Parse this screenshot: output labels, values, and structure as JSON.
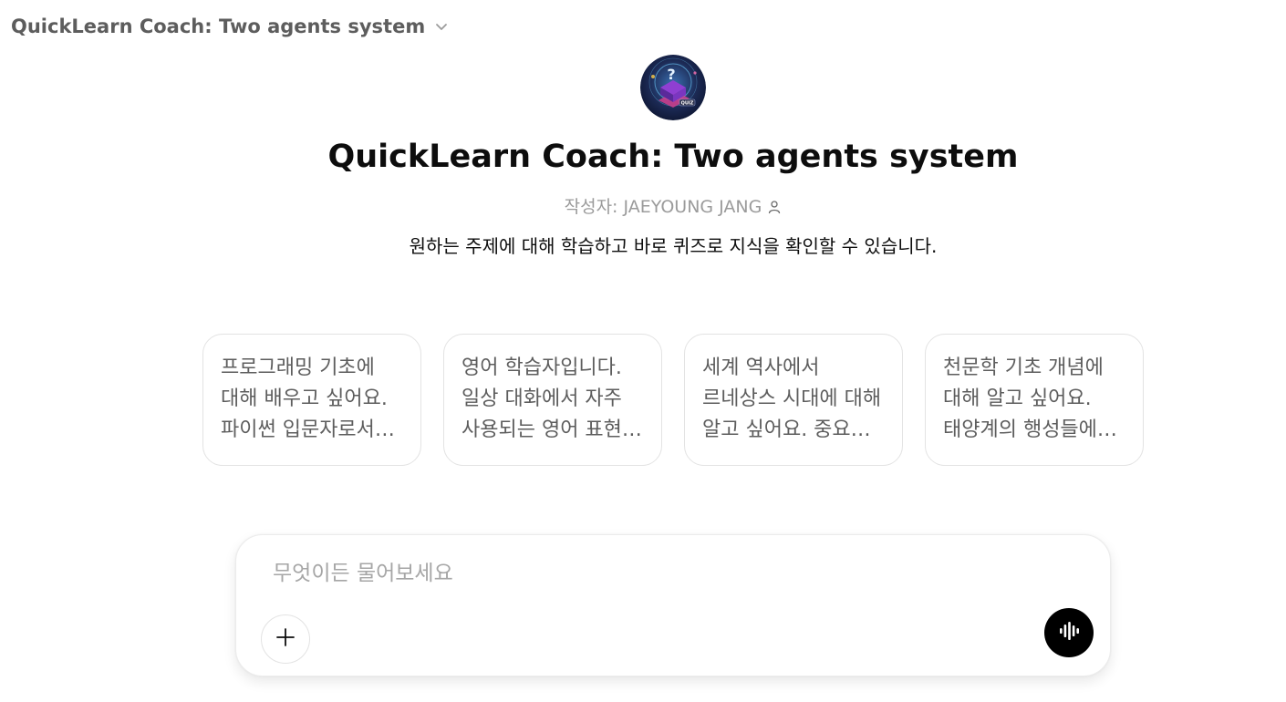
{
  "header": {
    "title": "QuickLearn Coach: Two agents system",
    "dropdown_icon": "chevron-down-icon"
  },
  "gpt": {
    "avatar_icon": "quiz-book-avatar",
    "name": "QuickLearn Coach: Two agents system",
    "author": "작성자: JAEYOUNG JANG",
    "author_icon": "person-icon",
    "description": "원하는 주제에 대해 학습하고 바로 퀴즈로 지식을 확인할 수 있습니다."
  },
  "starters": [
    {
      "text": "프로그래밍 기초에 대해 배우고 싶어요. 파이썬 입문자로서 알아야 할 기본 개념을 설명해 주세요."
    },
    {
      "text": "영어 학습자입니다. 일상 대화에서 자주 사용되는 영어 표현을 알려주세요."
    },
    {
      "text": "세계 역사에서 르네상스 시대에 대해 알고 싶어요. 중요한 사건과 인물을 알려주세요."
    },
    {
      "text": "천문학 기초 개념에 대해 알고 싶어요. 태양계의 행성들에 대해 설명해 주세요."
    }
  ],
  "composer": {
    "placeholder": "무엇이든 물어보세요",
    "value": "",
    "add_icon": "plus-icon",
    "voice_icon": "voice-waveform-icon"
  },
  "colors": {
    "accent_dark": "#000000",
    "muted_text": "#9b9b9b",
    "card_border": "#e3e3e3"
  }
}
